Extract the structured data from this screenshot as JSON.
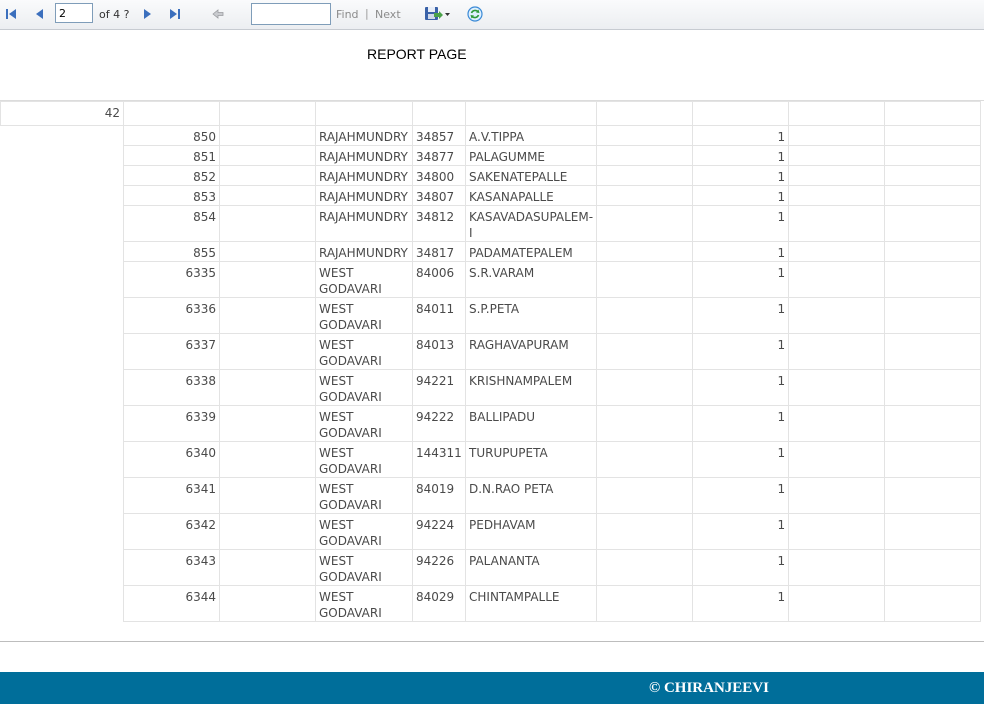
{
  "toolbar": {
    "page_current": "2",
    "page_of": "of 4 ?",
    "find_placeholder": "",
    "find_label": "Find",
    "separator": "|",
    "next_label": "Next"
  },
  "report": {
    "title": "REPORT PAGE",
    "group_value": "42",
    "rows": [
      [
        "850",
        "",
        "RAJAHMUNDRY",
        "34857",
        "A.V.TIPPA",
        "",
        "1",
        "",
        ""
      ],
      [
        "851",
        "",
        "RAJAHMUNDRY",
        "34877",
        "PALAGUMME",
        "",
        "1",
        "",
        ""
      ],
      [
        "852",
        "",
        "RAJAHMUNDRY",
        "34800",
        "SAKENATEPALLE",
        "",
        "1",
        "",
        ""
      ],
      [
        "853",
        "",
        "RAJAHMUNDRY",
        "34807",
        "KASANAPALLE",
        "",
        "1",
        "",
        ""
      ],
      [
        "854",
        "",
        "RAJAHMUNDRY",
        "34812",
        "KASAVADASUPALEM-I",
        "",
        "1",
        "",
        ""
      ],
      [
        "855",
        "",
        "RAJAHMUNDRY",
        "34817",
        "PADAMATEPALEM",
        "",
        "1",
        "",
        ""
      ],
      [
        "6335",
        "",
        "WEST GODAVARI",
        "84006",
        "S.R.VARAM",
        "",
        "1",
        "",
        ""
      ],
      [
        "6336",
        "",
        "WEST GODAVARI",
        "84011",
        "S.P.PETA",
        "",
        "1",
        "",
        ""
      ],
      [
        "6337",
        "",
        "WEST GODAVARI",
        "84013",
        "RAGHAVAPURAM",
        "",
        "1",
        "",
        ""
      ],
      [
        "6338",
        "",
        "WEST GODAVARI",
        "94221",
        "KRISHNAMPALEM",
        "",
        "1",
        "",
        ""
      ],
      [
        "6339",
        "",
        "WEST GODAVARI",
        "94222",
        "BALLIPADU",
        "",
        "1",
        "",
        ""
      ],
      [
        "6340",
        "",
        "WEST GODAVARI",
        "144311",
        "TURUPUPETA",
        "",
        "1",
        "",
        ""
      ],
      [
        "6341",
        "",
        "WEST GODAVARI",
        "84019",
        "D.N.RAO PETA",
        "",
        "1",
        "",
        ""
      ],
      [
        "6342",
        "",
        "WEST GODAVARI",
        "94224",
        "PEDHAVAM",
        "",
        "1",
        "",
        ""
      ],
      [
        "6343",
        "",
        "WEST GODAVARI",
        "94226",
        "PALANANTA",
        "",
        "1",
        "",
        ""
      ],
      [
        "6344",
        "",
        "WEST GODAVARI",
        "84029",
        "CHINTAMPALLE",
        "",
        "1",
        "",
        ""
      ]
    ]
  },
  "footer": {
    "text": "© CHIRANJEEVI"
  },
  "icons": {
    "first": "first-page-icon",
    "prev": "previous-page-icon",
    "next": "next-page-icon",
    "last": "last-page-icon",
    "back": "back-to-parent-icon",
    "export": "export-save-icon",
    "refresh": "refresh-icon"
  },
  "colors": {
    "footer_bg": "#006e9a",
    "nav_blue": "#3b6fbd"
  }
}
